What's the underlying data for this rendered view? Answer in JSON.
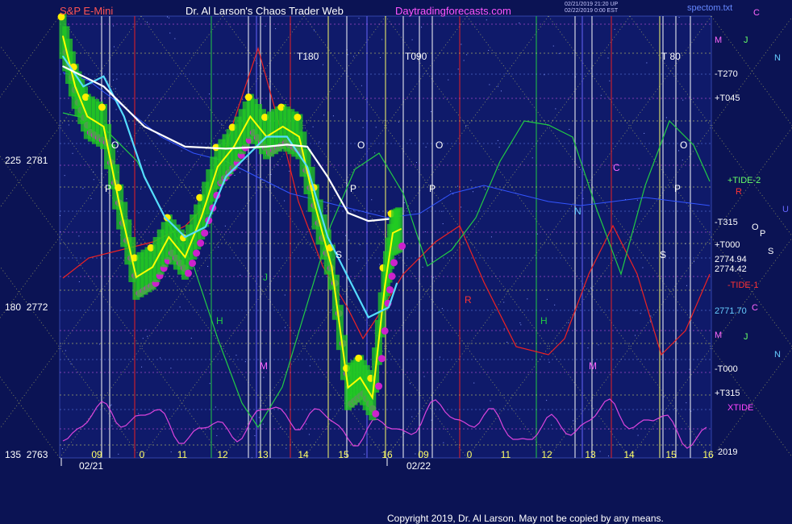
{
  "header": {
    "symbol": "S&P E-Mini",
    "title": "Dr. Al Larson's Chaos Trader Web",
    "site": "Daytradingforecasts.com",
    "stamp_line1": "02/21/2019 21:20 UP",
    "stamp_line2": "02/22/2019 0:00 EST",
    "spec_file": "spectom.txt"
  },
  "y_axis": [
    {
      "angle": "225",
      "price": "2781"
    },
    {
      "angle": "180",
      "price": "2772"
    },
    {
      "angle": "135",
      "price": "2763"
    }
  ],
  "right_labels": [
    {
      "text": "C",
      "color": "#ff66ff"
    },
    {
      "text": "M",
      "color": "#ff66ff"
    },
    {
      "text": "J",
      "color": "#66ff66"
    },
    {
      "text": "N",
      "color": "#66ccff"
    },
    {
      "text": "-T270",
      "color": "#ffffff"
    },
    {
      "text": "+T045",
      "color": "#ffffff"
    },
    {
      "text": "+TIDE-2",
      "color": "#66ff66"
    },
    {
      "text": "R",
      "color": "#ff3333"
    },
    {
      "text": "U",
      "color": "#6666ff"
    },
    {
      "text": "-T315",
      "color": "#ffffff"
    },
    {
      "text": "O",
      "color": "#ffffff"
    },
    {
      "text": "P",
      "color": "#ffffff"
    },
    {
      "text": "+T000",
      "color": "#ffffff"
    },
    {
      "text": "S",
      "color": "#ffffff"
    },
    {
      "text": "2774.94",
      "color": "#ffffff"
    },
    {
      "text": "2774.42",
      "color": "#ffffff"
    },
    {
      "text": "-TIDE-1",
      "color": "#ff3333"
    },
    {
      "text": "2771.70",
      "color": "#66ccff"
    },
    {
      "text": "C",
      "color": "#ff66ff"
    },
    {
      "text": "M",
      "color": "#ff66ff"
    },
    {
      "text": "J",
      "color": "#66ff66"
    },
    {
      "text": "N",
      "color": "#66ccff"
    },
    {
      "text": "-T000",
      "color": "#ffffff"
    },
    {
      "text": "+T315",
      "color": "#ffffff"
    },
    {
      "text": "XTIDE",
      "color": "#ff44ff"
    },
    {
      "text": "2019",
      "color": "#ffffff"
    }
  ],
  "chart_labels": {
    "t180": "T180",
    "t090": "T090",
    "t80": "T 80",
    "o": "O",
    "p": "P",
    "s": "S",
    "h": "H",
    "j": "J",
    "m": "M",
    "n": "N",
    "r": "R",
    "c": "C"
  },
  "colors": {
    "background": "#0b1354",
    "price_bar": "#22cc22",
    "price_line": "#ffff00",
    "avg_cyan": "#55ddff",
    "avg_white": "#ffffff",
    "xtide": "#dd44dd",
    "red_line": "#ee2222",
    "green_line": "#22cc44",
    "grid_yellow": "#ffff66",
    "magenta_dot": "#cc22cc",
    "yellow_dot": "#ffee00"
  },
  "chart_data": {
    "type": "line",
    "x_hour_ticks": [
      "09",
      "0",
      "11",
      "12",
      "13",
      "14",
      "15",
      "16",
      "09",
      "0",
      "11",
      "12",
      "13",
      "14",
      "15",
      "16"
    ],
    "date_labels": [
      "02/21",
      "02/22"
    ],
    "ylim": [
      2763,
      2785
    ],
    "series": [
      {
        "x": [
          0,
          0.3,
          0.6,
          1,
          1.4,
          1.8,
          2.2,
          2.6,
          3,
          3.4,
          3.8,
          4.2,
          4.6,
          5,
          5.4,
          5.8,
          6.2,
          6.6,
          7,
          7.3,
          7.6,
          7.9,
          8.1,
          8.3
        ],
        "y": [
          2784,
          2781.5,
          2780,
          2779.5,
          2775.5,
          2772,
          2772.5,
          2774,
          2773,
          2775,
          2777.5,
          2778.5,
          2780,
          2779,
          2779.5,
          2779,
          2775.5,
          2772.5,
          2766.5,
          2767,
          2766,
          2771.5,
          2774.2,
          2774.4
        ]
      },
      {
        "x": [
          0,
          0.5,
          1,
          1.5,
          2,
          2.5,
          3,
          3.5,
          4,
          4.5,
          5,
          5.5,
          6,
          6.5,
          7,
          7.5,
          8,
          8.2
        ],
        "y": [
          2783,
          2781.5,
          2782,
          2780,
          2777,
          2775,
          2774,
          2774.5,
          2777,
          2778,
          2779,
          2779,
          2777.5,
          2774,
          2772,
          2770,
          2770.5,
          2771.7
        ]
      },
      {
        "x": [
          0,
          0.5,
          1,
          1.5,
          2,
          3,
          4,
          5,
          5.5,
          6,
          6.5,
          7,
          7.5,
          8
        ],
        "y": [
          2782.5,
          2782,
          2781.5,
          2780.5,
          2779.5,
          2778.5,
          2778.4,
          2778.5,
          2778.6,
          2778.5,
          2777,
          2775.2,
          2774.8,
          2774.9
        ]
      }
    ]
  },
  "copyright": "Copyright 2019, Dr. Al Larson. May not be copied by any means."
}
